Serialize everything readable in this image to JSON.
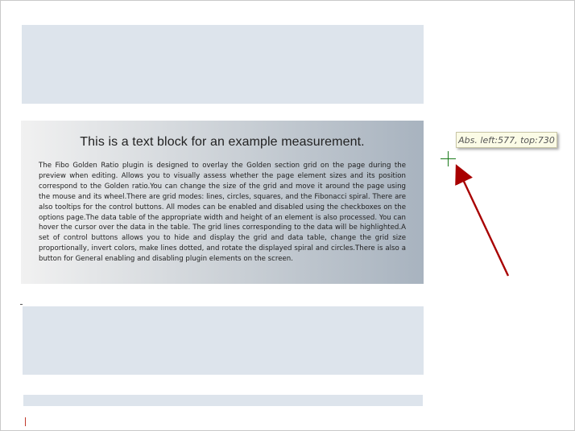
{
  "text_block": {
    "heading": "This is a text block for an example measurement.",
    "body": "The Fibo Golden Ratio plugin is designed to overlay the Golden section grid on the page during the preview when editing. Allows you to visually assess whether the page element sizes and its position correspond to the Golden ratio.You can change the size of the grid and move it around the page using the mouse and its wheel.There are grid modes: lines, circles, squares, and the Fibonacci spiral. There are also tooltips for the control buttons. All modes can be enabled and disabled using the checkboxes on the options page.The data table of the appropriate width and height of an element is also processed. You can hover the cursor over the data in the table. The grid lines corresponding to the data will be highlighted.A set of control buttons allows you to hide and display the grid and data table, change the grid size proportionally, invert colors, make lines dotted, and rotate the displayed spiral and circles.There is also a button for General enabling and disabling plugin elements on the screen."
  },
  "tooltip": {
    "text": "Abs. left:577, top:730"
  },
  "icons": {
    "cursor": "crosshair-icon",
    "pointer": "arrow-icon"
  },
  "colors": {
    "placeholder": "#dde4ec",
    "crosshair": "#1a7a1a",
    "arrow": "#a80000",
    "tooltip_bg": "#fbfbe6"
  }
}
